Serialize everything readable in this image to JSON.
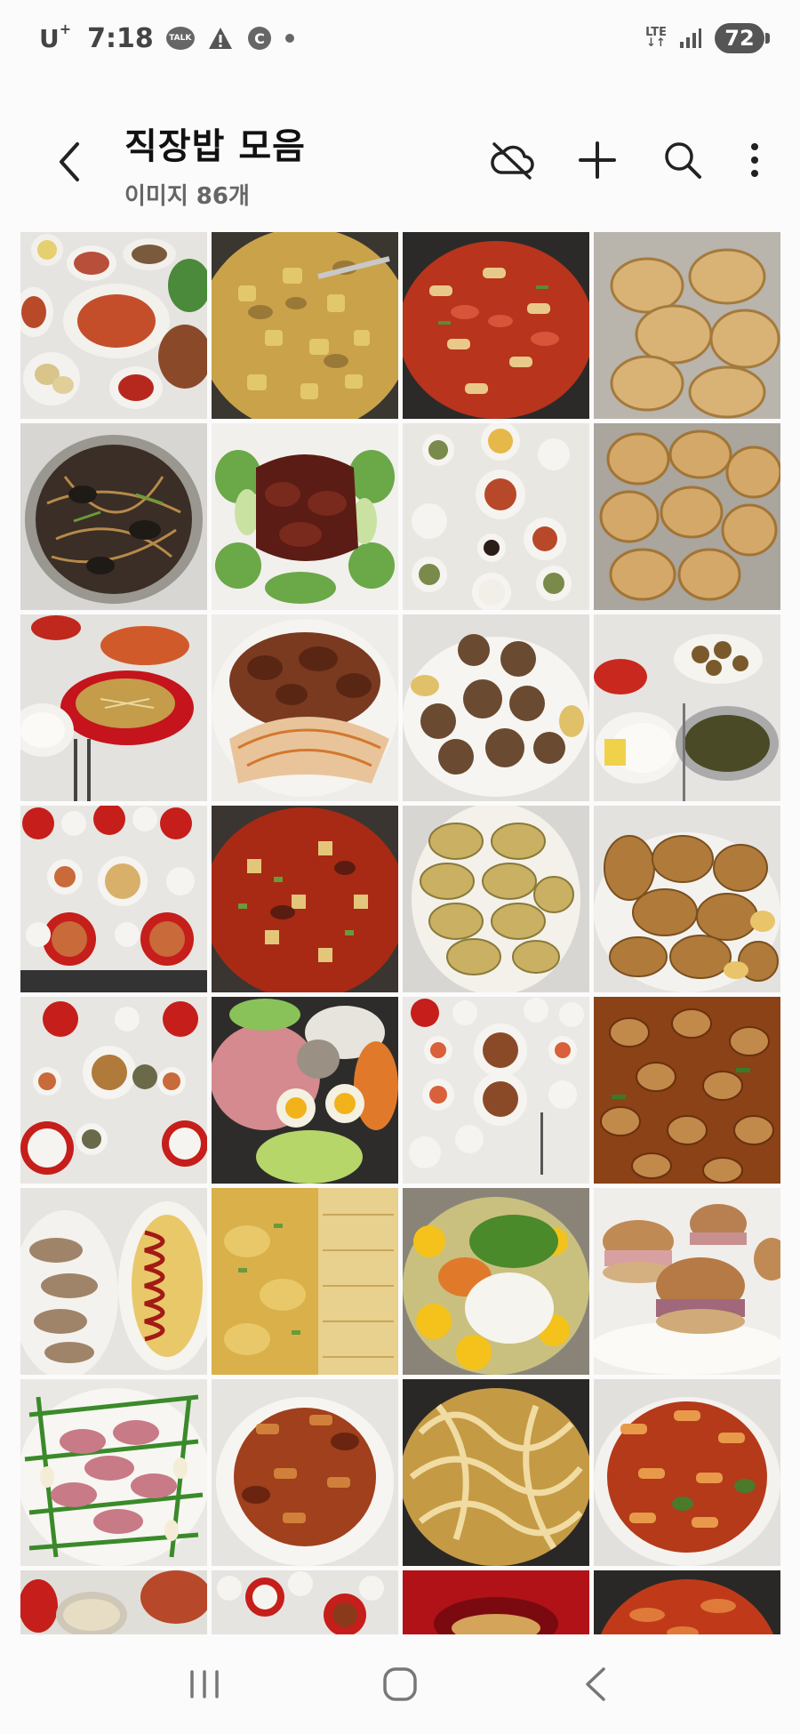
{
  "status_bar": {
    "carrier": "U",
    "carrier_sup": "+",
    "time": "7:18",
    "notification_icons": [
      "talk-icon",
      "warning-icon",
      "c-icon",
      "dot-icon"
    ],
    "talk_label": "TALK",
    "c_label": "C",
    "network_type": "LTE",
    "battery_level": "72"
  },
  "header": {
    "title": "직장밥 모음",
    "subtitle": "이미지 86개",
    "actions": [
      "cloud-off-icon",
      "add-icon",
      "search-icon",
      "more-icon"
    ]
  },
  "grid": {
    "photo_descriptions": [
      "korean-table-spread",
      "potato-curry-stew",
      "spicy-tteokbokki",
      "fried-potato-pancakes",
      "japchae-mushrooms",
      "braised-pork-bokchoy",
      "banchan-table",
      "fried-meat-pancakes",
      "soup-kimchi-table",
      "braised-pork-kimchi",
      "fried-meatballs",
      "rice-seaweed-soup",
      "table-spread-bowls",
      "spicy-kimchi-stew",
      "vegetable-pancakes",
      "fried-tonkatsu",
      "table-with-dishes",
      "raw-meat-eggs-veggies",
      "lunch-table-setting",
      "spicy-stir-fry-chicken",
      "grilled-fish-omelette",
      "rolled-egg-omelette",
      "egg-vegetable-mix",
      "slider-burgers",
      "sausage-garlic-chives",
      "spicy-stir-fry-pork",
      "udon-noodles",
      "spicy-rice-cakes",
      "pan-dumplings",
      "lunch-trays",
      "red-bowl-rice-cakes",
      "red-sauce-pan"
    ],
    "colors": {
      "sauce_red": "#b8341c",
      "curry_yellow": "#c9a24a",
      "fried_brown": "#b5803e",
      "table_white": "#e8e6e2",
      "dark_pan": "#2c2a28",
      "green_veg": "#4f8a3a"
    }
  },
  "nav": {
    "buttons": [
      "recents-icon",
      "home-icon",
      "back-nav-icon"
    ]
  }
}
